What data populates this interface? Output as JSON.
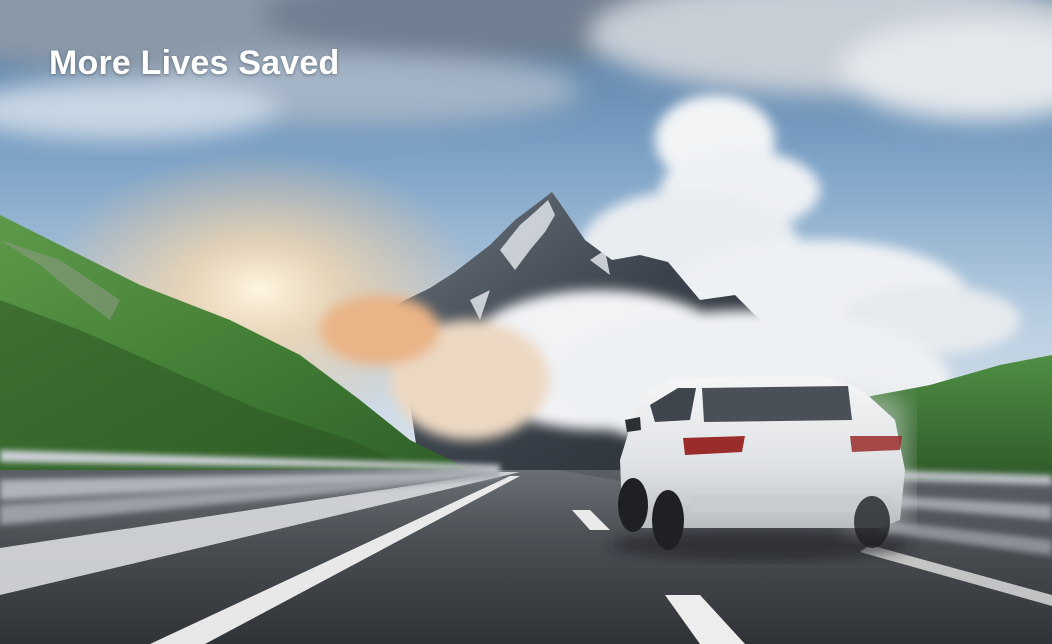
{
  "banner": {
    "headline": "More Lives Saved"
  },
  "colors": {
    "sky": "#7ea3c9",
    "road": "#45494e",
    "car": "#e8eaec",
    "hills": "#4f8a3c",
    "headline_text": "#ffffff"
  },
  "scene": {
    "subject": "white SUV driving on highway toward mountain",
    "elements": [
      "sky-with-clouds",
      "mountain-peak",
      "green-hillside",
      "highway-road",
      "guardrails",
      "white-suv",
      "sun-glow"
    ]
  }
}
